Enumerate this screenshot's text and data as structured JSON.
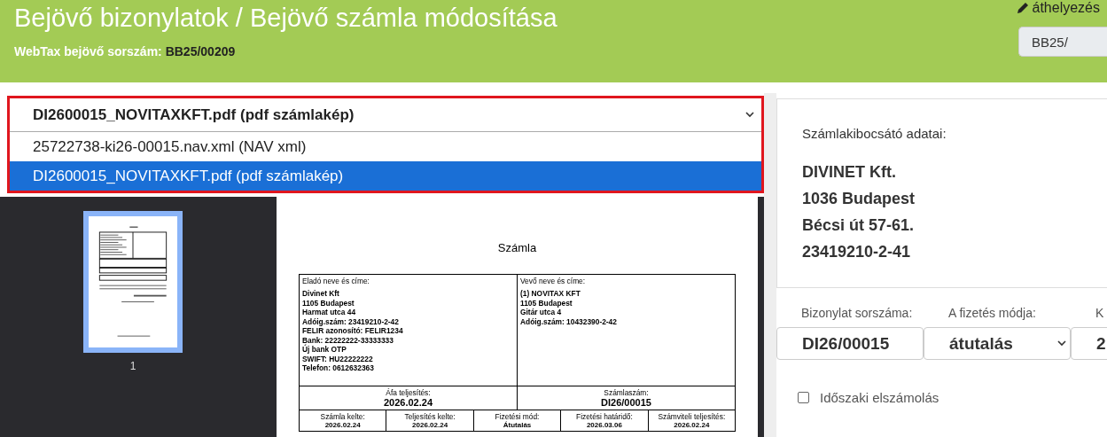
{
  "header": {
    "title": "Bejövő bizonylatok / Bejövő számla módosítása",
    "serial_label": "WebTax bejövő sorszám:",
    "serial_value": "BB25/00209",
    "move_link": "áthelyezés",
    "prefix_field": {
      "value": "BB25/"
    }
  },
  "file_select": {
    "value": "DI2600015_NOVITAXKFT.pdf (pdf számlakép)",
    "expanded": true,
    "options": [
      {
        "label": "25722738-ki26-00015.nav.xml (NAV xml)",
        "selected": false
      },
      {
        "label": "DI2600015_NOVITAXKFT.pdf (pdf számlakép)",
        "selected": true
      }
    ]
  },
  "viewer": {
    "thumbnails": [
      {
        "page": "1",
        "selected": true
      }
    ],
    "document": {
      "title": "Számla",
      "seller": {
        "label": "Eladó neve és címe:",
        "lines": [
          "Divinet Kft",
          "1105 Budapest",
          "Harmat utca 44",
          "Adóig.szám: 23419210-2-42",
          "FELIR azonosító: FELIR1234",
          "Bank: 22222222-33333333",
          "Új bank OTP",
          "SWIFT: HU22222222",
          "Telefon: 0612632363"
        ]
      },
      "buyer": {
        "label": "Vevő neve és címe:",
        "lines": [
          "(1)  NOVITAX KFT",
          "1105 Budapest",
          "Gitár utca 4",
          "Adóig.szám: 10432390-2-42"
        ]
      },
      "row1": [
        {
          "label": "Áfa teljesítés:",
          "value": "2026.02.24"
        },
        {
          "label": "Számlaszám:",
          "value": "DI26/00015"
        }
      ],
      "row2": [
        {
          "label": "Számla kelte:",
          "value": "2026.02.24"
        },
        {
          "label": "Teljesítés kelte:",
          "value": "2026.02.24"
        },
        {
          "label": "Fizetési mód:",
          "value": "Átutalás"
        },
        {
          "label": "Fizetési határidő:",
          "value": "2026.03.06"
        },
        {
          "label": "Számviteli teljesítés:",
          "value": "2026.02.24"
        }
      ]
    }
  },
  "issuer": {
    "label": "Számlakibocsátó adatai:",
    "lines": [
      "DIVINET Kft.",
      "1036 Budapest",
      "Bécsi út 57-61.",
      "23419210-2-41"
    ]
  },
  "fields": [
    {
      "kind": "input",
      "label": "Bizonylat sorszáma:",
      "value": "DI26/00015"
    },
    {
      "kind": "select",
      "label": "A fizetés módja:",
      "value": "átutalás"
    },
    {
      "kind": "input",
      "label": "K",
      "value": "2"
    }
  ],
  "periodic": {
    "label": "Időszaki elszámolás",
    "checked": false
  }
}
